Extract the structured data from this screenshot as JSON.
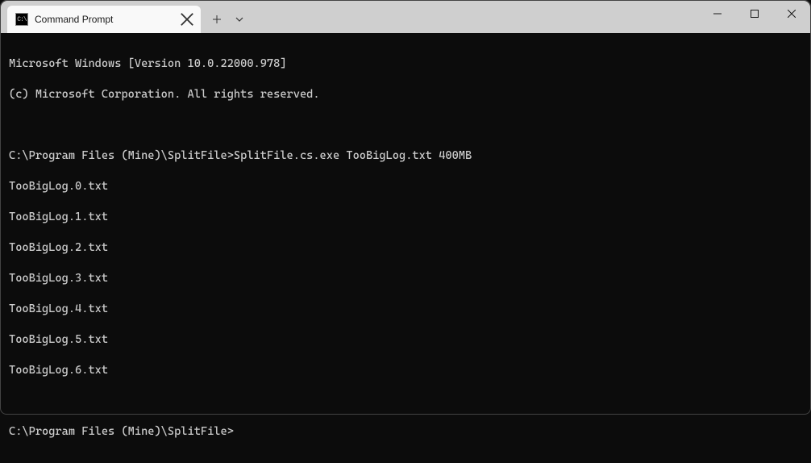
{
  "tab": {
    "title": "Command Prompt",
    "icon_label": "C:\\"
  },
  "terminal": {
    "header_line1": "Microsoft Windows [Version 10.0.22000.978]",
    "header_line2": "(c) Microsoft Corporation. All rights reserved.",
    "prompt1": "C:\\Program Files (Mine)\\SplitFile>",
    "command1": "SplitFile.cs.exe TooBigLog.txt 400MB",
    "output": [
      "TooBigLog.0.txt",
      "TooBigLog.1.txt",
      "TooBigLog.2.txt",
      "TooBigLog.3.txt",
      "TooBigLog.4.txt",
      "TooBigLog.5.txt",
      "TooBigLog.6.txt"
    ],
    "prompt2": "C:\\Program Files (Mine)\\SplitFile>"
  }
}
